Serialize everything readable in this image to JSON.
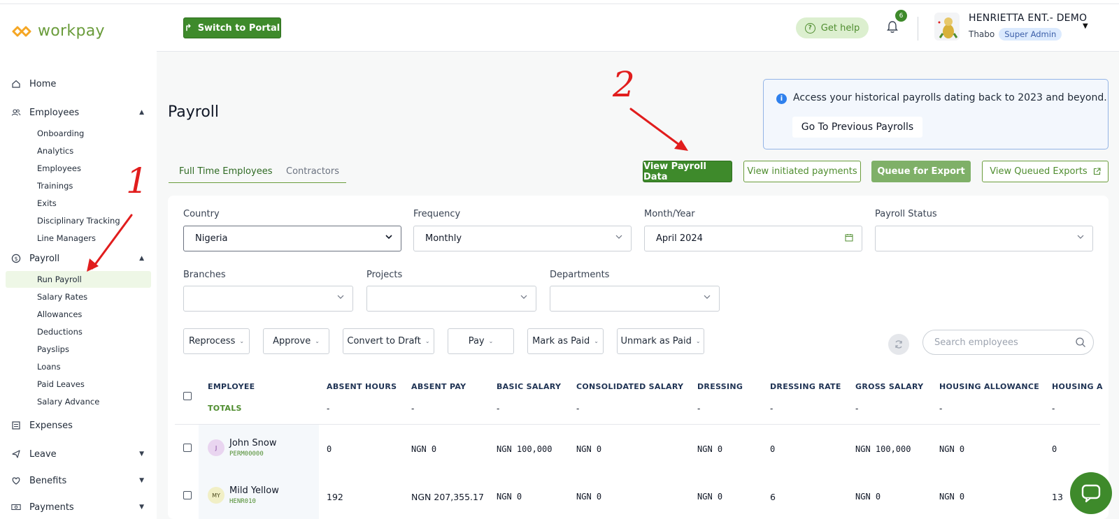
{
  "brand": {
    "name": "workpay"
  },
  "sidebar": {
    "items": [
      {
        "label": "Home",
        "icon": "home-icon"
      },
      {
        "label": "Employees",
        "icon": "users-icon"
      },
      {
        "label": "Payroll",
        "icon": "dollar-icon"
      },
      {
        "label": "Expenses",
        "icon": "receipt-icon"
      },
      {
        "label": "Leave",
        "icon": "plane-icon"
      },
      {
        "label": "Benefits",
        "icon": "heart-icon"
      },
      {
        "label": "Payments",
        "icon": "cash-icon"
      }
    ],
    "employees_sub": [
      "Onboarding",
      "Analytics",
      "Employees",
      "Trainings",
      "Exits",
      "Disciplinary Tracking",
      "Line Managers"
    ],
    "payroll_sub": [
      "Run Payroll",
      "Salary Rates",
      "Allowances",
      "Deductions",
      "Payslips",
      "Loans",
      "Paid Leaves",
      "Salary Advance"
    ]
  },
  "header": {
    "switch_label": "Switch to Portal",
    "help_label": "Get help",
    "notif_count": "6",
    "company": "HENRIETTA ENT.- DEMO",
    "user_name": "Thabo",
    "user_role": "Super Admin"
  },
  "page": {
    "title": "Payroll"
  },
  "info": {
    "text": "Access your historical payrolls dating back to 2023 and beyond.",
    "button": "Go To Previous Payrolls"
  },
  "tabs": [
    "Full Time Employees",
    "Contractors"
  ],
  "actions": {
    "view_payroll_data": "View Payroll Data",
    "view_initiated": "View initiated payments",
    "queue_export": "Queue for Export",
    "view_queued": "View Queued Exports"
  },
  "filters": {
    "country": {
      "label": "Country",
      "value": "Nigeria"
    },
    "frequency": {
      "label": "Frequency",
      "value": "Monthly"
    },
    "month_year": {
      "label": "Month/Year",
      "value": "April 2024"
    },
    "payroll_status": {
      "label": "Payroll Status",
      "value": ""
    },
    "branches": {
      "label": "Branches",
      "value": ""
    },
    "projects": {
      "label": "Projects",
      "value": ""
    },
    "departments": {
      "label": "Departments",
      "value": ""
    }
  },
  "bulk_actions": [
    "Reprocess",
    "Approve",
    "Convert to Draft",
    "Pay",
    "Mark as Paid",
    "Unmark as Paid"
  ],
  "search": {
    "placeholder": "Search employees"
  },
  "table": {
    "columns": [
      "EMPLOYEE",
      "ABSENT HOURS",
      "ABSENT PAY",
      "BASIC SALARY",
      "CONSOLIDATED SALARY",
      "DRESSING",
      "DRESSING RATE",
      "GROSS SALARY",
      "HOUSING ALLOWANCE",
      "HOUSING A"
    ],
    "totals_label": "TOTALS",
    "totals": [
      "-",
      "-",
      "-",
      "-",
      "-",
      "-",
      "-",
      "-",
      "-"
    ],
    "rows": [
      {
        "initials": "J",
        "name": "John Snow",
        "code": "PERM00000",
        "cells": [
          "0",
          "NGN 0",
          "NGN 100,000",
          "NGN 0",
          "NGN 0",
          "0",
          "NGN 100,000",
          "NGN 0",
          "0"
        ]
      },
      {
        "initials": "MY",
        "name": "Mild Yellow",
        "code": "HENR010",
        "cells": [
          "192",
          "NGN 207,355.17",
          "NGN 0",
          "NGN 0",
          "NGN 0",
          "6",
          "NGN 0",
          "NGN 0",
          "13"
        ]
      }
    ]
  },
  "annotations": {
    "one": "1",
    "two": "2"
  },
  "colors": {
    "brand_green": "#3e8a2b",
    "annotation_red": "#e11d1d",
    "info_blue": "#2f80ed"
  }
}
